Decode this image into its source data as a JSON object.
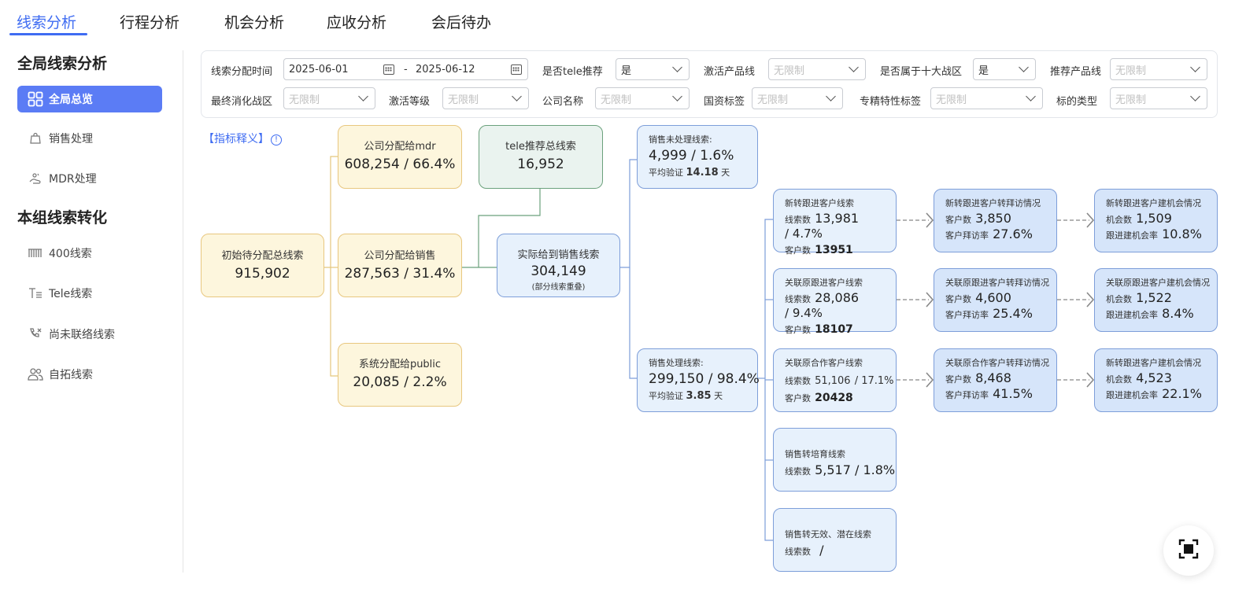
{
  "tabs": [
    {
      "label": "线索分析"
    },
    {
      "label": "行程分析"
    },
    {
      "label": "机会分析"
    },
    {
      "label": "应收分析"
    },
    {
      "label": "会后待办"
    }
  ],
  "sidebar": {
    "section1_title": "全局线索分析",
    "section2_title": "本组线索转化",
    "items": [
      {
        "label": "全局总览",
        "icon": "grid-icon",
        "active": true
      },
      {
        "label": "销售处理",
        "icon": "bag-icon"
      },
      {
        "label": "MDR处理",
        "icon": "hand-icon"
      },
      {
        "label": "400线索",
        "icon": "barcode-icon"
      },
      {
        "label": "Tele线索",
        "icon": "text-lines-icon"
      },
      {
        "label": "尚未联络线索",
        "icon": "phone-missed-icon"
      },
      {
        "label": "自拓线索",
        "icon": "users-icon"
      }
    ]
  },
  "filters": {
    "date_label": "线索分配时间",
    "date_start": "2025-06-01",
    "date_sep": "-",
    "date_end": "2025-06-12",
    "tele_label": "是否tele推荐",
    "tele_value": "是",
    "active_line_label": "激活产品线",
    "active_line_placeholder": "无限制",
    "ten_zone_label": "是否属于十大战区",
    "ten_zone_value": "是",
    "rec_line_label": "推荐产品线",
    "rec_line_placeholder": "无限制",
    "final_zone_label": "最终消化战区",
    "final_zone_placeholder": "无限制",
    "active_level_label": "激活等级",
    "active_level_placeholder": "无限制",
    "company_label": "公司名称",
    "company_placeholder": "无限制",
    "state_tag_label": "国资标签",
    "state_tag_placeholder": "无限制",
    "special_tag_label": "专精特性标签",
    "special_tag_placeholder": "无限制",
    "target_type_label": "标的类型",
    "target_type_placeholder": "无限制"
  },
  "flow": {
    "indicator_link": "【指标释义】",
    "initial": {
      "title": "初始待分配总线索",
      "value": "915,902"
    },
    "mdr": {
      "title": "公司分配给mdr",
      "value": "608,254 / 66.4%"
    },
    "sales": {
      "title": "公司分配给销售",
      "value": "287,563 / 31.4%"
    },
    "public": {
      "title": "系统分配给public",
      "value": "20,085 / 2.2%"
    },
    "tele": {
      "title": "tele推荐总线索",
      "value": "16,952"
    },
    "actual": {
      "title": "实际给到销售线索",
      "value": "304,149",
      "note": "(部分线索重叠)"
    },
    "unprocessed": {
      "title": "销售未处理线索:",
      "value": "4,999 / 1.6%",
      "avg_label": "平均验证",
      "avg_value": "14.18",
      "avg_unit": "天"
    },
    "processed": {
      "title": "销售处理线索:",
      "value": "299,150 / 98.4%",
      "avg_label": "平均验证",
      "avg_value": "3.85",
      "avg_unit": "天"
    },
    "rows": [
      {
        "lead": {
          "title": "新转跟进客户线索",
          "count_label": "线索数",
          "count_value": "13,981",
          "count_pct": "/ 4.7%",
          "cust_label": "客户数",
          "cust_value": "13951"
        },
        "visit": {
          "title": "新转跟进客户转拜访情况",
          "cust_label": "客户数",
          "cust_value": "3,850",
          "rate_label": "客户拜访率",
          "rate_value": "27.6%"
        },
        "opp": {
          "title": "新转跟进客户建机会情况",
          "opp_label": "机会数",
          "opp_value": "1,509",
          "rate_label": "跟进建机会率",
          "rate_value": "10.8%"
        }
      },
      {
        "lead": {
          "title": "关联原跟进客户线索",
          "count_label": "线索数",
          "count_value": "28,086",
          "count_pct": "/ 9.4%",
          "cust_label": "客户数",
          "cust_value": "18107"
        },
        "visit": {
          "title": "关联原跟进客户转拜访情况",
          "cust_label": "客户数",
          "cust_value": "4,600",
          "rate_label": "客户拜访率",
          "rate_value": "25.4%"
        },
        "opp": {
          "title": "关联原跟进客户建机会情况",
          "opp_label": "机会数",
          "opp_value": "1,522",
          "rate_label": "跟进建机会率",
          "rate_value": "8.4%"
        }
      },
      {
        "lead": {
          "title": "关联原合作客户线索",
          "count_label": "线索数",
          "count_value": "51,106",
          "count_pct": "/ 17.1%",
          "cust_label": "客户数",
          "cust_value": "20428"
        },
        "visit": {
          "title": "关联原合作客户转拜访情况",
          "cust_label": "客户数",
          "cust_value": "8,468",
          "rate_label": "客户拜访率",
          "rate_value": "41.5%"
        },
        "opp": {
          "title": "新转跟进客户建机会情况",
          "opp_label": "机会数",
          "opp_value": "4,523",
          "rate_label": "跟进建机会率",
          "rate_value": "22.1%"
        }
      }
    ],
    "nurture": {
      "title": "销售转培育线索",
      "count_label": "线索数",
      "count_value": "5,517 / 1.8%"
    },
    "invalid": {
      "title": "销售转无效、潜在线索",
      "count_label": "线索数",
      "count_value": "/"
    }
  }
}
